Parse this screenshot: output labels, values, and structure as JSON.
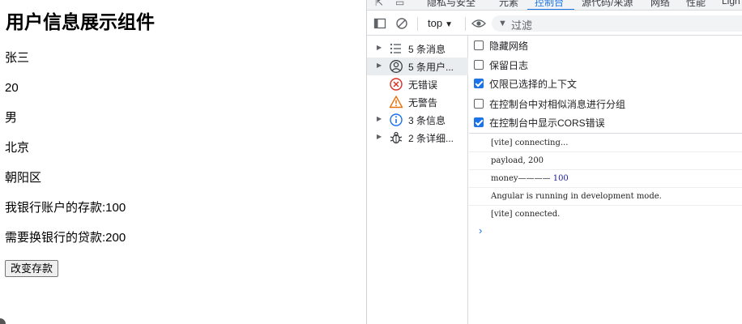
{
  "app": {
    "title": "用户信息展示组件",
    "name": "张三",
    "age": "20",
    "gender": "男",
    "city": "北京",
    "district": "朝阳区",
    "deposit_line": "我银行账户的存款:100",
    "loan_line": "需要换银行的贷款:200",
    "change_button": "改变存款"
  },
  "devtools": {
    "tabs": [
      "隐私与安全",
      "元素",
      "控制台",
      "源代码/来源",
      "网络",
      "性能",
      "Ligh"
    ],
    "active_tab": "控制台",
    "context": "top",
    "filter_placeholder": "过滤",
    "sidebar": [
      {
        "label": "5 条消息",
        "icon": "list-icon",
        "expandable": true
      },
      {
        "label": "5 条用户...",
        "icon": "user-icon",
        "expandable": true,
        "selected": true
      },
      {
        "label": "无错误",
        "icon": "error-icon",
        "expandable": false
      },
      {
        "label": "无警告",
        "icon": "warning-icon",
        "expandable": false
      },
      {
        "label": "3 条信息",
        "icon": "info-icon",
        "expandable": true
      },
      {
        "label": "2 条详细...",
        "icon": "bug-icon",
        "expandable": true
      }
    ],
    "settings": [
      {
        "label": "隐藏网络",
        "checked": false
      },
      {
        "label": "保留日志",
        "checked": false
      },
      {
        "label": "仅限已选择的上下文",
        "checked": true
      },
      {
        "label": "在控制台中对相似消息进行分组",
        "checked": false
      },
      {
        "label": "在控制台中显示CORS错误",
        "checked": true
      }
    ],
    "messages": {
      "m1": "[vite] connecting...",
      "m2": "payload, 200",
      "m3_text": "money———— ",
      "m3_num": "100",
      "m4": "Angular is running in development mode.",
      "m5": "[vite] connected."
    },
    "prompt": "›",
    "colors": {
      "accent": "#1a73e8",
      "error": "#d93025",
      "warning": "#e8710a"
    }
  }
}
